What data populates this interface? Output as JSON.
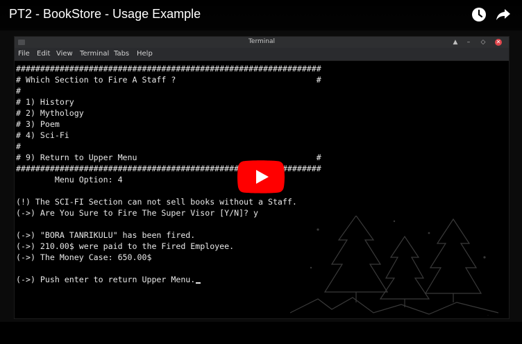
{
  "video": {
    "title": "PT2 - BookStore - Usage Example",
    "watch_later_icon": "clock-icon",
    "share_icon": "share-arrow-icon",
    "play_icon": "youtube-play-icon"
  },
  "terminal": {
    "title": "Terminal",
    "menu": [
      "File",
      "Edit",
      "View",
      "Terminal",
      "Tabs",
      "Help"
    ],
    "window_controls": [
      "up-arrow-icon",
      "minimize-icon",
      "maximize-icon",
      "close-icon"
    ],
    "lines": [
      "###############################################################",
      "# Which Section to Fire A Staff ?                             #",
      "#",
      "# 1) History",
      "# 2) Mythology",
      "# 3) Poem",
      "# 4) Sci-Fi",
      "#",
      "# 9) Return to Upper Menu                                     #",
      "###############################################################",
      "        Menu Option: 4",
      "",
      "(!) The SCI-FI Section can not sell books without a Staff.",
      "(->) Are You Sure to Fire The Super Visor [Y/N]? y",
      "",
      "(->) \"BORA TANRIKULU\" has been fired.",
      "(->) 210.00$ were paid to the Fired Employee.",
      "(->) The Money Case: 650.00$",
      "",
      "(->) Push enter to return Upper Menu."
    ]
  },
  "colors": {
    "background": "#000000",
    "text": "#e8e8e8",
    "play_button": "#ff0000",
    "close_button": "#e0464c"
  }
}
